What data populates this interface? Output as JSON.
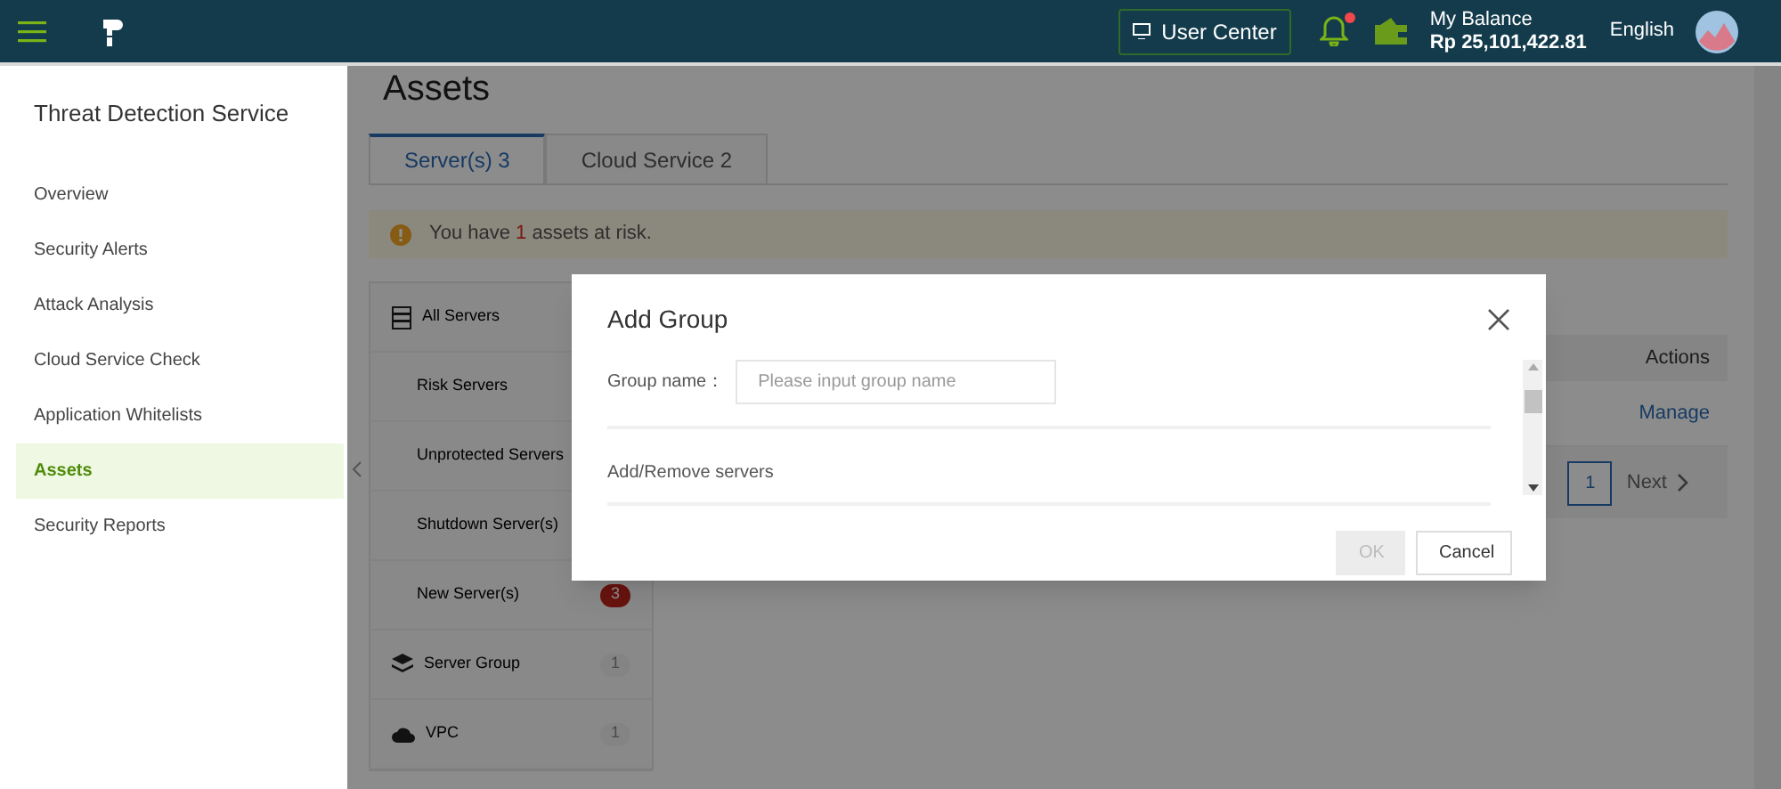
{
  "header": {
    "user_center": "User Center",
    "notification_dot": true,
    "balance_label": "My Balance",
    "balance": "Rp 25,101,422.81",
    "language": "English"
  },
  "sidebar": {
    "title": "Threat Detection Service",
    "items": [
      {
        "label": "Overview",
        "selected": false
      },
      {
        "label": "Security Alerts",
        "selected": false
      },
      {
        "label": "Attack Analysis",
        "selected": false
      },
      {
        "label": "Cloud Service Check",
        "selected": false
      },
      {
        "label": "Application Whitelists",
        "selected": false
      },
      {
        "label": "Assets",
        "selected": true
      },
      {
        "label": "Security Reports",
        "selected": false
      }
    ]
  },
  "page_title": "Assets",
  "tabs": [
    {
      "label": "Server(s) 3",
      "selected": true
    },
    {
      "label": "Cloud Service 2",
      "selected": false
    }
  ],
  "alert": {
    "before": "You have ",
    "count": "1",
    "after": " assets at risk."
  },
  "server_list": [
    {
      "label": "All Servers",
      "kind": "group"
    },
    {
      "label": "Risk Servers",
      "kind": "sub"
    },
    {
      "label": "Unprotected Servers",
      "kind": "sub"
    },
    {
      "label": "Shutdown Server(s)",
      "kind": "sub"
    },
    {
      "label": "New Server(s)",
      "kind": "sub",
      "count": "3",
      "alert": true
    },
    {
      "label": "Server Group",
      "kind": "group",
      "count": "1",
      "alert": false
    },
    {
      "label": "VPC",
      "kind": "group",
      "count": "1",
      "alert": false
    }
  ],
  "table": {
    "columns": [
      "Actions"
    ],
    "rows": [
      [
        "Manage"
      ]
    ]
  },
  "pagination": {
    "pages": [
      {
        "label": "1",
        "selected": true
      }
    ],
    "next": "Next"
  },
  "dialog": {
    "title": "Add Group",
    "field_label": "Group name：",
    "placeholder": "Please input group name",
    "section": "Add/Remove servers",
    "buttons": [
      {
        "label": "OK",
        "disabled": true
      },
      {
        "label": "Cancel",
        "disabled": false
      }
    ]
  }
}
